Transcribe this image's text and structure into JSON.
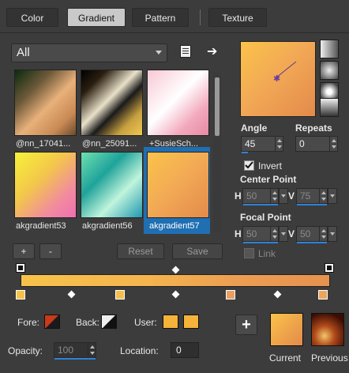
{
  "tabs": [
    {
      "label": "Color",
      "active": false
    },
    {
      "label": "Gradient",
      "active": true
    },
    {
      "label": "Pattern",
      "active": false
    },
    {
      "label": "Texture",
      "active": false
    }
  ],
  "category": {
    "selected": "All"
  },
  "gallery": {
    "items": [
      {
        "label": "@nn_17041...",
        "selected": false
      },
      {
        "label": "@nn_25091...",
        "selected": false
      },
      {
        "label": "+SusieSch...",
        "selected": false
      },
      {
        "label": "akgradient53",
        "selected": false
      },
      {
        "label": "akgradient56",
        "selected": false
      },
      {
        "label": "akgradient57",
        "selected": true
      }
    ],
    "add_label": "+",
    "remove_label": "-",
    "reset_label": "Reset",
    "save_label": "Save"
  },
  "angle": {
    "label": "Angle",
    "value": "45"
  },
  "repeats": {
    "label": "Repeats",
    "value": "0"
  },
  "invert": {
    "label": "Invert",
    "checked": true
  },
  "center_point": {
    "label": "Center Point",
    "h_label": "H",
    "h_value": "50",
    "v_label": "V",
    "v_value": "75"
  },
  "focal_point": {
    "label": "Focal Point",
    "h_label": "H",
    "h_value": "50",
    "v_label": "V",
    "v_value": "50"
  },
  "link": {
    "label": "Link",
    "checked": false
  },
  "editor": {
    "fore_label": "Fore:",
    "back_label": "Back:",
    "user_label": "User:",
    "opacity_label": "Opacity:",
    "opacity_value": "100",
    "location_label": "Location:",
    "location_value": "0",
    "add_stop_label": "+"
  },
  "compare": {
    "current_label": "Current",
    "previous_label": "Previous"
  },
  "colors": {
    "accent": "#2c84d8",
    "stop_start": "#f7c24a",
    "stop_end": "#e6924e",
    "user_color": "#f6b33a"
  }
}
